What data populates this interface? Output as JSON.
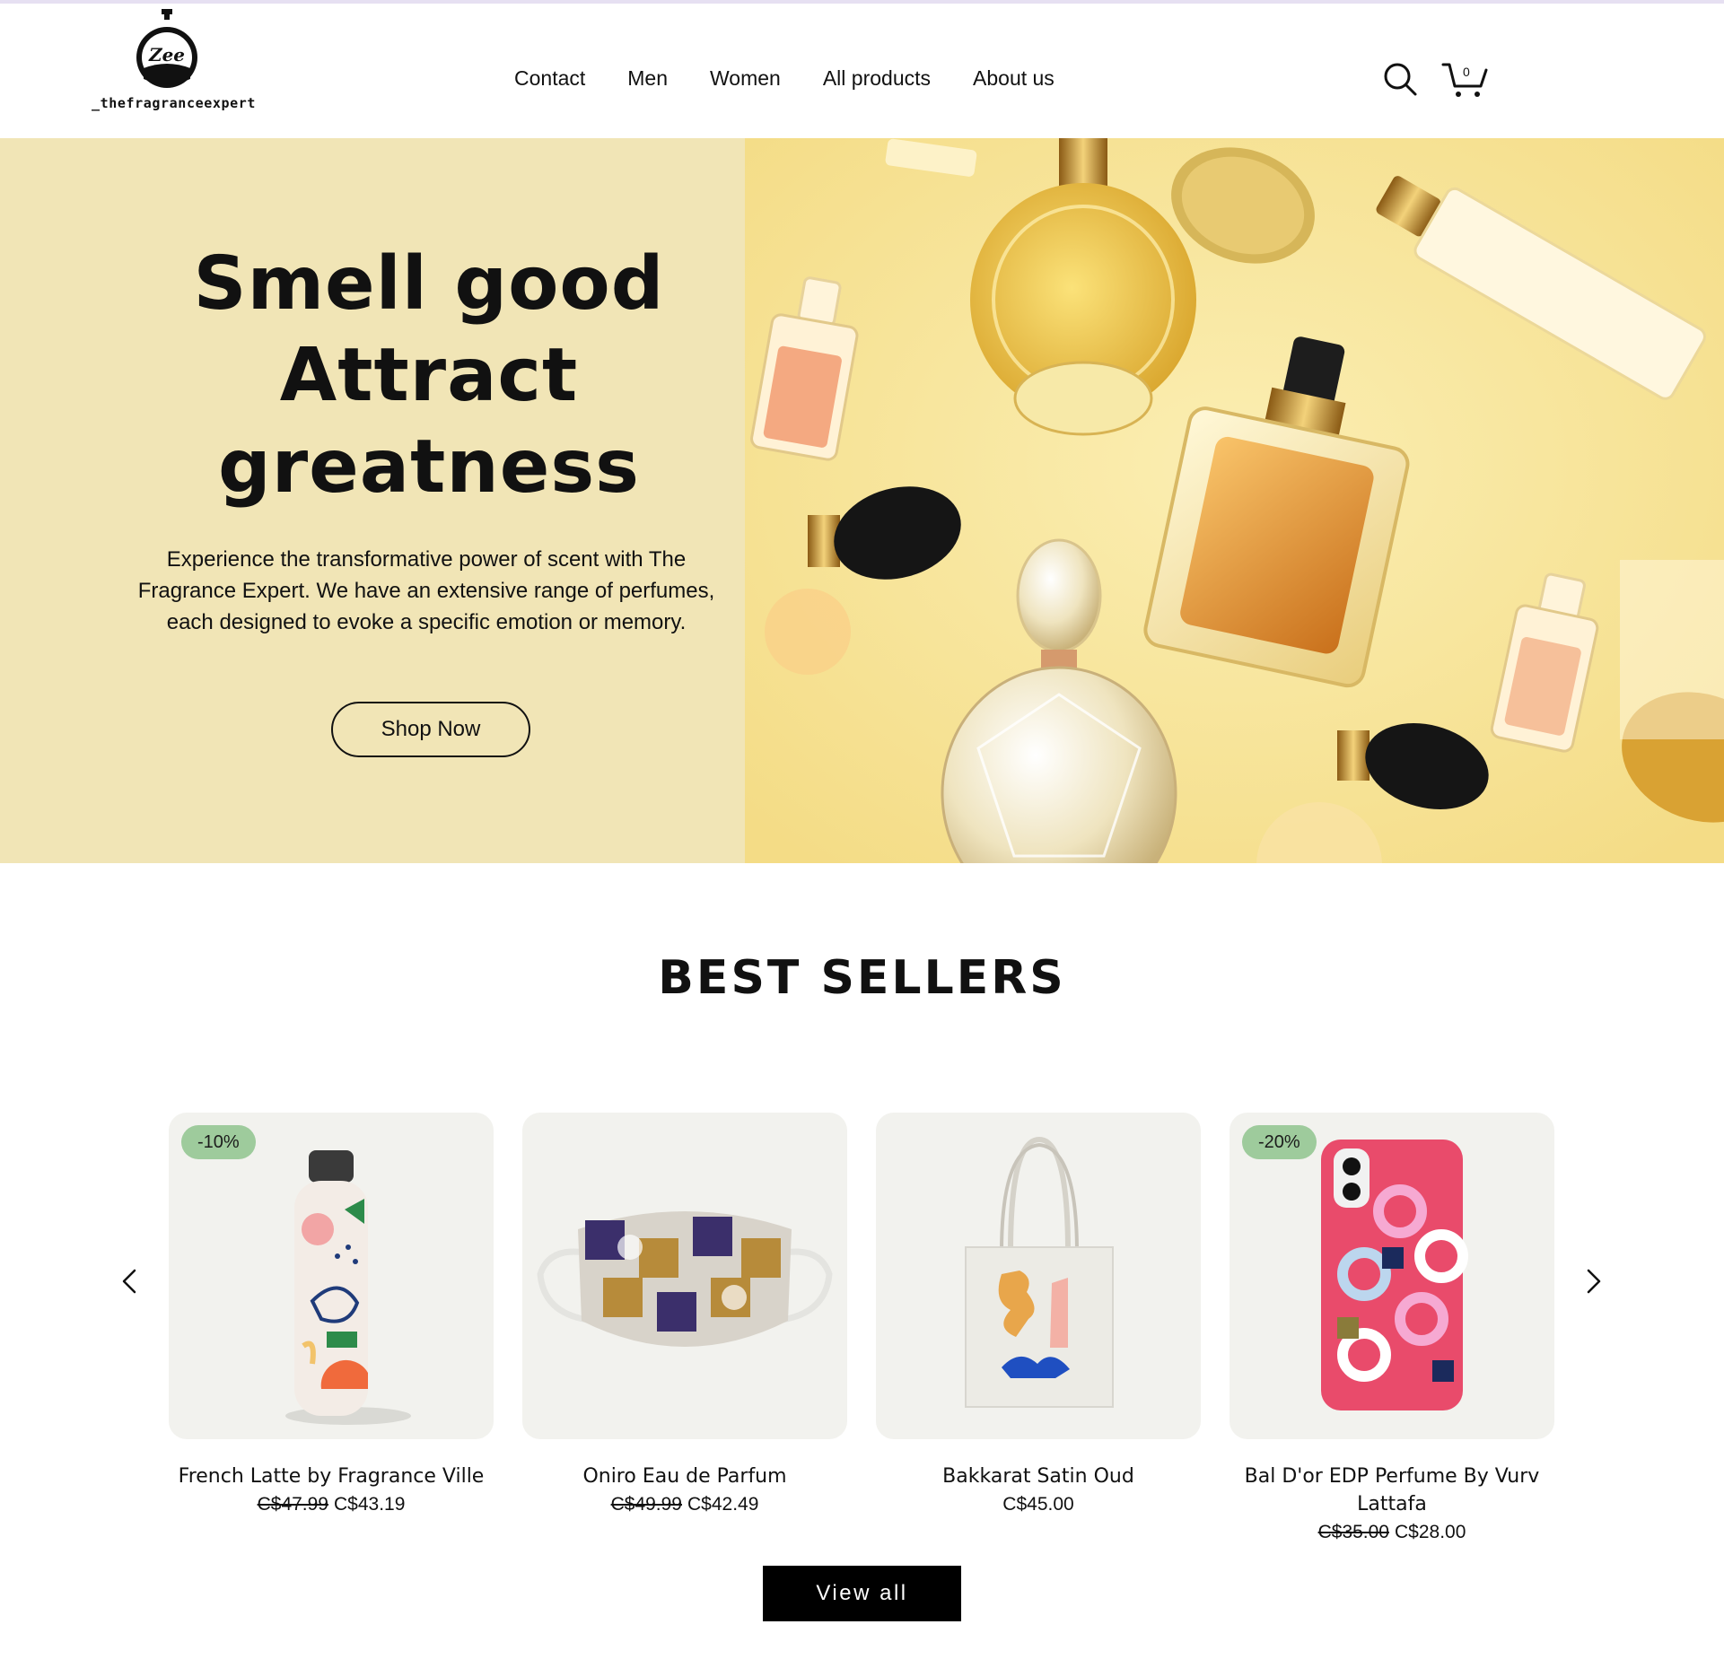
{
  "brand": {
    "logo_text": "_thefragranceexpert",
    "logo_mark_text": "Zee"
  },
  "nav": {
    "items": [
      {
        "label": "Contact"
      },
      {
        "label": "Men"
      },
      {
        "label": "Women"
      },
      {
        "label": "All products"
      },
      {
        "label": "About us"
      }
    ]
  },
  "header_icons": {
    "search_icon": "search-icon",
    "cart_icon": "cart-icon",
    "cart_count": "0"
  },
  "hero": {
    "title_lines": [
      "Smell good",
      "Attract",
      "greatness"
    ],
    "body": "Experience the transformative power of scent with The Fragrance Expert. We have an extensive range of perfumes, each designed to evoke a specific emotion or memory.",
    "cta_label": "Shop Now",
    "image_subject": "perfume bottles on yellow background"
  },
  "best_sellers": {
    "title": "BEST SELLERS",
    "prev_icon": "chevron-left-icon",
    "next_icon": "chevron-right-icon",
    "products": [
      {
        "name": "French Latte by Fragrance Ville",
        "old_price": "C$47.99",
        "price": "C$43.19",
        "badge": "-10%",
        "image": "patterned water bottle"
      },
      {
        "name": "Oniro Eau de Parfum",
        "old_price": "C$49.99",
        "price": "C$42.49",
        "badge": "",
        "image": "patterned face mask"
      },
      {
        "name": "Bakkarat Satin Oud",
        "old_price": "",
        "price": "C$45.00",
        "badge": "",
        "image": "printed tote bag"
      },
      {
        "name": "Bal D'or EDP Perfume By Vurv Lattafa",
        "old_price": "C$35.00",
        "price": "C$28.00",
        "badge": "-20%",
        "image": "patterned phone case"
      }
    ],
    "view_all_label": "View all"
  },
  "colors": {
    "hero_left_bg": "#f1e5b6",
    "hero_right_bg": "#f7e49a",
    "badge_bg": "#9ecb9c",
    "card_bg": "#f2f2ee",
    "view_all_bg": "#000000"
  }
}
